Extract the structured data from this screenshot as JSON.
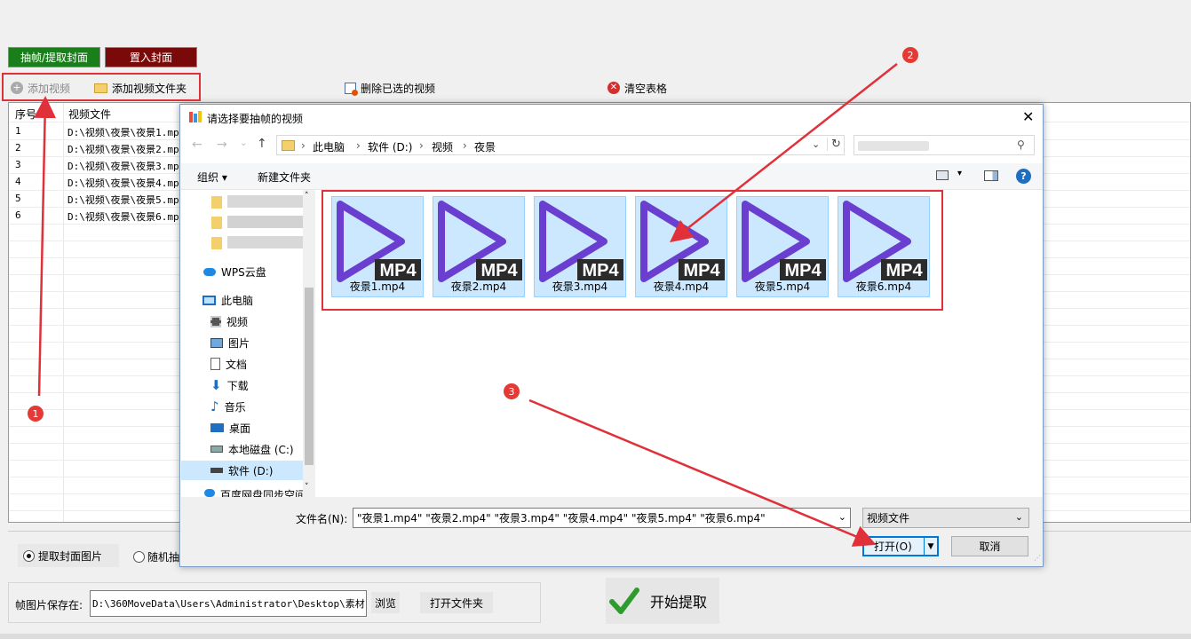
{
  "modes": {
    "extract": "抽帧/提取封面",
    "embed": "置入封面"
  },
  "toolbar": {
    "add_video": "添加视频",
    "add_folder": "添加视频文件夹",
    "delete_selected": "删除已选的视频",
    "clear_table": "清空表格"
  },
  "table": {
    "headers": [
      "序号",
      "视频文件"
    ],
    "rows": [
      {
        "no": "1",
        "path": "D:\\视频\\夜景\\夜景1.mp"
      },
      {
        "no": "2",
        "path": "D:\\视频\\夜景\\夜景2.mp"
      },
      {
        "no": "3",
        "path": "D:\\视频\\夜景\\夜景3.mp"
      },
      {
        "no": "4",
        "path": "D:\\视频\\夜景\\夜景4.mp"
      },
      {
        "no": "5",
        "path": "D:\\视频\\夜景\\夜景5.mp"
      },
      {
        "no": "6",
        "path": "D:\\视频\\夜景\\夜景6.mp"
      }
    ]
  },
  "options": {
    "cover": "提取封面图片",
    "random": "随机抽"
  },
  "save": {
    "label": "帧图片保存在:",
    "path": "D:\\360MoveData\\Users\\Administrator\\Desktop\\素材",
    "browse": "浏览",
    "open_folder": "打开文件夹"
  },
  "start_button": "开始提取",
  "dialog": {
    "title": "请选择要抽帧的视频",
    "breadcrumb": [
      "此电脑",
      "软件 (D:)",
      "视频",
      "夜景"
    ],
    "organize": "组织",
    "new_folder": "新建文件夹",
    "nav": {
      "wps": "WPS云盘",
      "pc": "此电脑",
      "video": "视频",
      "pictures": "图片",
      "documents": "文档",
      "downloads": "下载",
      "music": "音乐",
      "desktop": "桌面",
      "local_c": "本地磁盘 (C:)",
      "soft_d": "软件 (D:)",
      "cut": "百度网盘同步空间"
    },
    "file_badge": "MP4",
    "files": [
      "夜景1.mp4",
      "夜景2.mp4",
      "夜景3.mp4",
      "夜景4.mp4",
      "夜景5.mp4",
      "夜景6.mp4"
    ],
    "filename_label": "文件名(N):",
    "filename_value": "\"夜景1.mp4\" \"夜景2.mp4\" \"夜景3.mp4\" \"夜景4.mp4\" \"夜景5.mp4\" \"夜景6.mp4\"",
    "filetype": "视频文件",
    "open": "打开(O)",
    "cancel": "取消"
  },
  "annotations": [
    "1",
    "2",
    "3"
  ],
  "colors": {
    "extract_bg": "#1a7f1a",
    "embed_bg": "#7a0a0a",
    "annotation": "#e0303a",
    "play": "#6a3fd0",
    "selected": "#cce8ff"
  }
}
